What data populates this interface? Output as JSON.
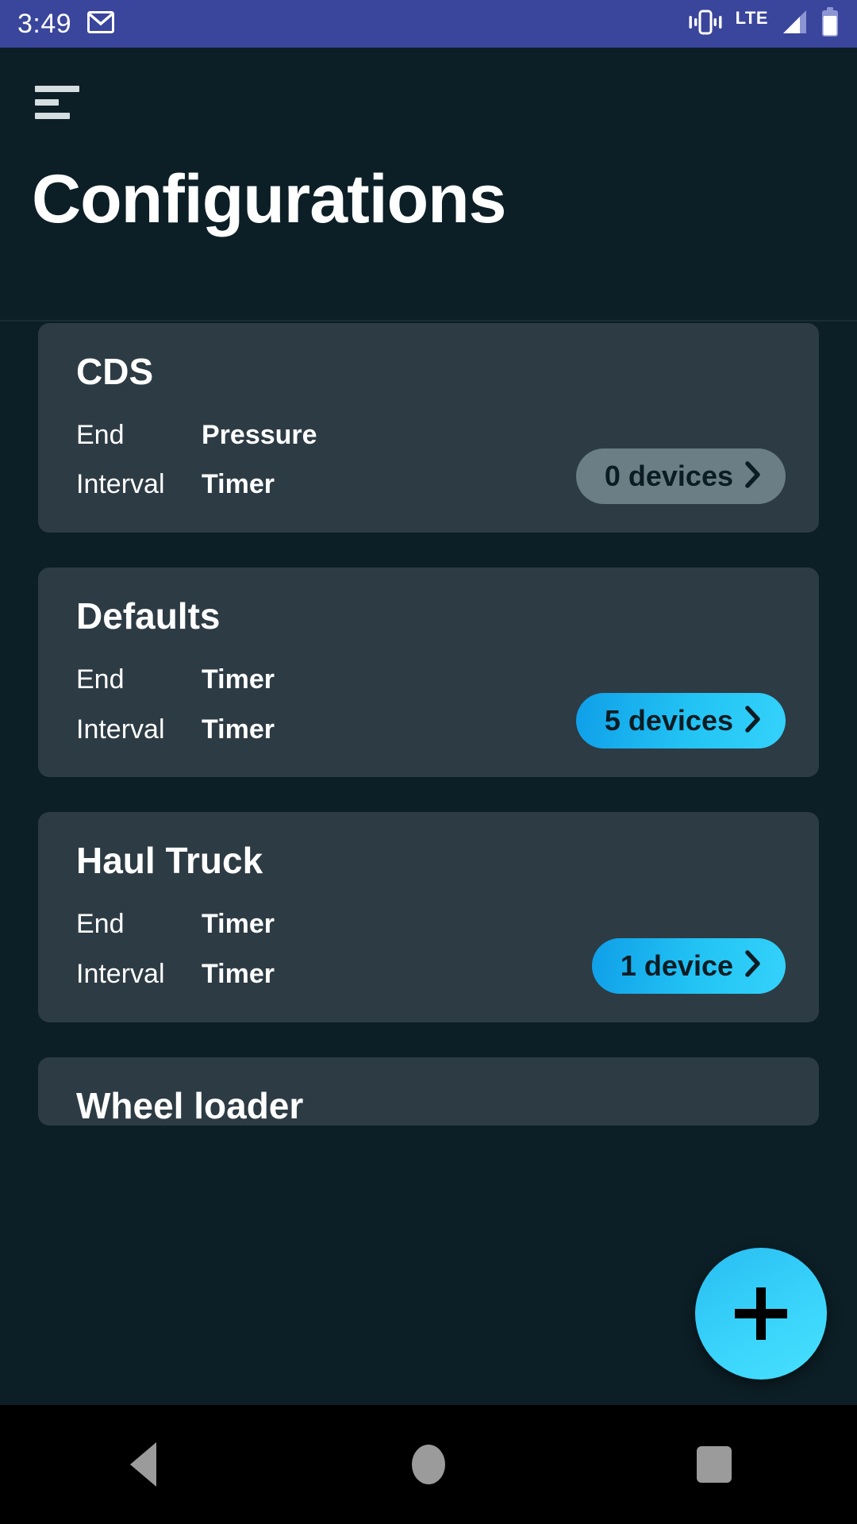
{
  "status_bar": {
    "time": "3:49",
    "network_type": "LTE",
    "icons": {
      "app_notification": "gmail-icon",
      "ringer": "vibrate-icon",
      "signal": "signal-bars-icon",
      "battery": "battery-icon"
    },
    "background_color": "#3a459c"
  },
  "app_bar": {
    "menu_icon": "hamburger-menu-icon",
    "title": "Configurations"
  },
  "labels": {
    "end": "End",
    "interval": "Interval"
  },
  "cards": [
    {
      "title": "CDS",
      "end_label": "End",
      "end_value": "Pressure",
      "interval_label": "Interval",
      "interval_value": "Timer",
      "devices_label": "0 devices",
      "devices_count": 0,
      "enabled": false
    },
    {
      "title": "Defaults",
      "end_label": "End",
      "end_value": "Timer",
      "interval_label": "Interval",
      "interval_value": "Timer",
      "devices_label": "5 devices",
      "devices_count": 5,
      "enabled": true
    },
    {
      "title": "Haul Truck",
      "end_label": "End",
      "end_value": "Timer",
      "interval_label": "Interval",
      "interval_value": "Timer",
      "devices_label": "1 device",
      "devices_count": 1,
      "enabled": true
    },
    {
      "title": "Wheel loader",
      "end_label": "",
      "end_value": "",
      "interval_label": "",
      "interval_value": "",
      "devices_label": "",
      "devices_count": null,
      "enabled": false
    }
  ],
  "fab": {
    "icon": "plus-icon",
    "label": "Add configuration"
  },
  "nav_bar": {
    "back": "back-icon",
    "home": "home-icon",
    "recents": "recents-icon"
  },
  "colors": {
    "accent_start": "#0f9fe8",
    "accent_end": "#34d2fb",
    "card_background": "#2d3b44",
    "page_background": "#0c1f26",
    "pill_disabled": "#6b7d85",
    "status_bar": "#3a459c"
  }
}
